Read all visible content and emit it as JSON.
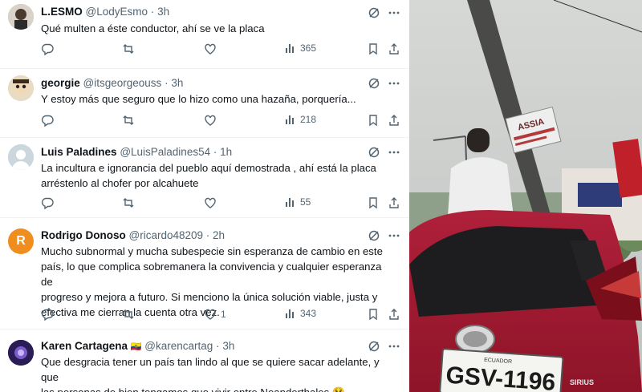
{
  "feed": {
    "tweets": [
      {
        "name": "L.ESMO",
        "handle": "@LodyEsmo",
        "time": "3h",
        "text": [
          "Qué multen a éste conductor, ahí se ve la placa"
        ],
        "views": "365",
        "likes": "",
        "avatar_color": "#b7a89a"
      },
      {
        "name": "georgie",
        "handle": "@itsgeorgeouss",
        "time": "3h",
        "text": [
          "Y estoy más que seguro que lo hizo como una hazaña, porquería..."
        ],
        "views": "218",
        "likes": "",
        "avatar_color": "#d8c5a0"
      },
      {
        "name": "Luis Paladines",
        "handle": "@LuisPaladines54",
        "time": "1h",
        "text": [
          "La incultura e ignorancia del pueblo aquí demostrada , ahí está la  placa",
          "arréstenlo al chofer por alcahuete"
        ],
        "views": "55",
        "likes": "",
        "avatar_color": "#ccd6dd"
      },
      {
        "name": "Rodrigo Donoso",
        "handle": "@ricardo48209",
        "time": "2h",
        "avatar_letter": "R",
        "text": [
          "Mucho subnormal y mucha subespecie sin esperanza de cambio en este",
          "país, lo que complica sobremanera la convivencia y cualquier esperanza de",
          "progreso y mejora a futuro. Si menciono la única solución viable, justa y",
          "efectiva me cierran la cuenta otra vez."
        ],
        "views": "343",
        "likes": "1",
        "avatar_color": "#ef8d1f"
      },
      {
        "name": "Karen Cartagena",
        "handle": "@karencartag",
        "time": "3h",
        "name_emoji": "🇪🇨",
        "text": [
          "Que desgracia tener un país tan lindo al que se quiere sacar adelante, y que",
          "las personas de bien tengamos que vivir entre Neanderthales 😫"
        ],
        "avatar_color": "#3b2a6b"
      }
    ],
    "dot": "·"
  },
  "photo": {
    "sign_text": "ASSIA",
    "plate_text": "GSV-1196",
    "plate_province": "ECUADOR",
    "car_brand": "SIRIUS",
    "icons": [
      "reply-icon",
      "retweet-icon",
      "like-icon",
      "views-icon",
      "bookmark-icon",
      "share-icon",
      "grok-icon",
      "more-icon"
    ]
  }
}
